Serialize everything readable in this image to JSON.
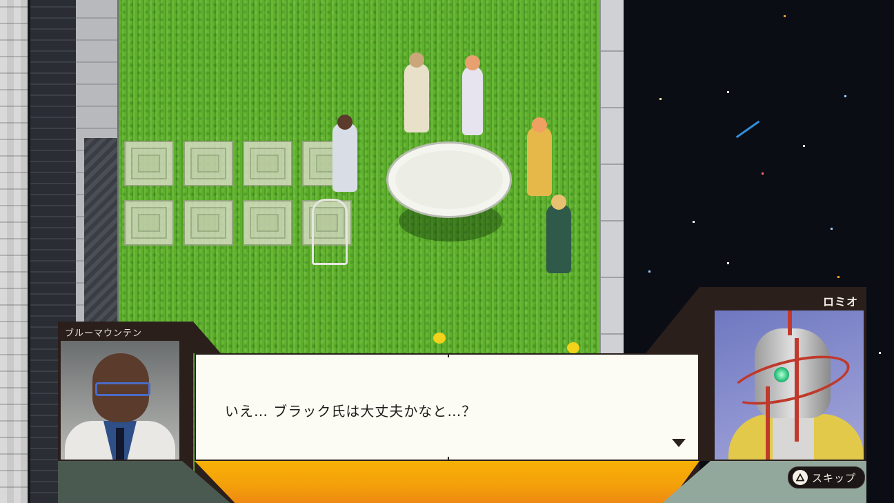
{
  "dialogue": {
    "left_speaker": "ブルーマウンテン",
    "right_speaker": "ロミオ",
    "text": "いえ… ブラック氏は大丈夫かなと…？"
  },
  "controls": {
    "skip_label": "スキップ",
    "skip_icon": "triangle-button-icon"
  },
  "colors": {
    "frame": "#2b1f1c",
    "dialog_bg": "#fdfcf4",
    "accent_orange": "#f4a10a",
    "lawn": "#5fae2e",
    "space": "#0b0d14"
  }
}
